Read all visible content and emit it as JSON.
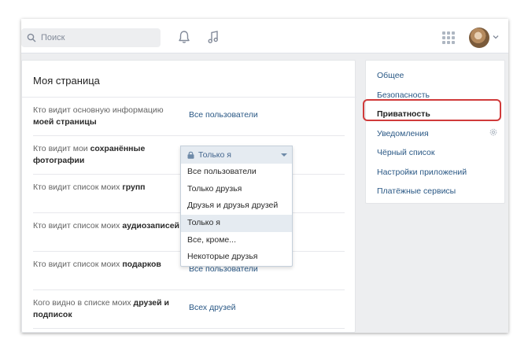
{
  "search": {
    "placeholder": "Поиск"
  },
  "header": {
    "icons": [
      "search-icon",
      "bell-icon",
      "music-icon",
      "apps-grid-icon",
      "chevron-down-icon"
    ]
  },
  "main": {
    "title": "Моя страница",
    "rows": [
      {
        "label_plain": "Кто видит основную информацию ",
        "label_bold": "моей страницы",
        "value": "Все пользователи"
      },
      {
        "label_plain": "Кто видит мои ",
        "label_bold": "сохранённые фотографии",
        "value": "Только я"
      },
      {
        "label_plain": "Кто видит список моих ",
        "label_bold": "групп",
        "value": ""
      },
      {
        "label_plain": "Кто видит список моих ",
        "label_bold": "аудиозаписей",
        "value": ""
      },
      {
        "label_plain": "Кто видит список моих ",
        "label_bold": "подарков",
        "value": "Все пользователи"
      },
      {
        "label_plain": "Кого видно в списке моих ",
        "label_bold": "друзей и подписок",
        "value": "Всех друзей"
      }
    ]
  },
  "dropdown": {
    "selected": "Только я",
    "options": [
      "Все пользователи",
      "Только друзья",
      "Друзья и друзья друзей",
      "Только я",
      "Все, кроме...",
      "Некоторые друзья"
    ],
    "active_index": 3
  },
  "sidebar": {
    "items": [
      {
        "label": "Общее"
      },
      {
        "label": "Безопасность"
      },
      {
        "label": "Приватность"
      },
      {
        "label": "Уведомления"
      },
      {
        "label": "Чёрный список"
      },
      {
        "label": "Настройки приложений"
      },
      {
        "label": "Платёжные сервисы"
      }
    ],
    "selected_index": 2
  },
  "colors": {
    "accent": "#2a5885",
    "highlight": "#d03a3a",
    "background": "#edeef0"
  }
}
